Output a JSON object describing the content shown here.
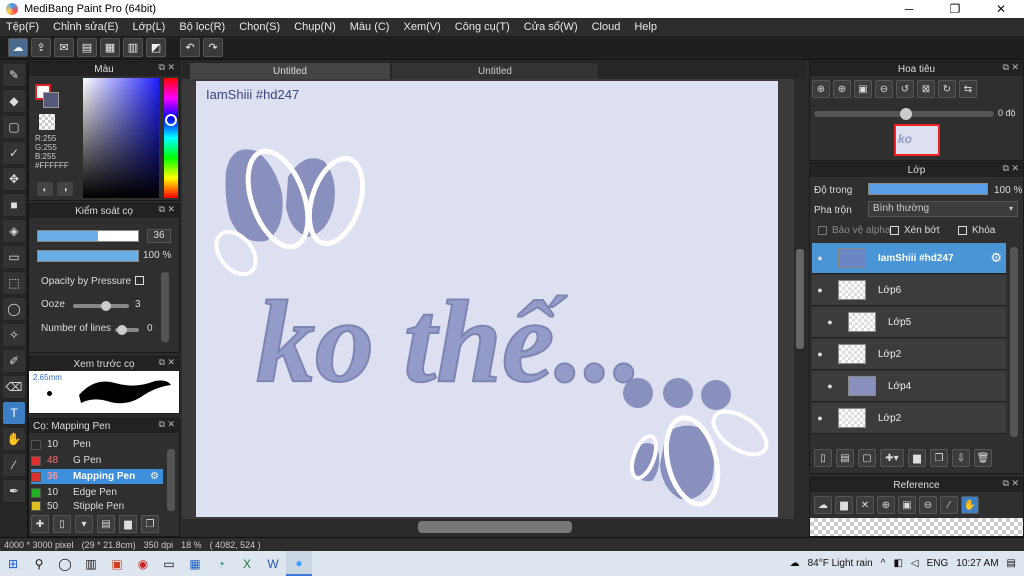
{
  "window": {
    "title": "MediBang Paint Pro (64bit)",
    "minimize": "─",
    "maximize": "❐",
    "close": "✕"
  },
  "menu": [
    "Tệp(F)",
    "Chỉnh sửa(E)",
    "Lớp(L)",
    "Bộ lọc(R)",
    "Chọn(S)",
    "Chụp(N)",
    "Màu (C)",
    "Xem(V)",
    "Công cụ(T)",
    "Cửa sổ(W)",
    "Cloud",
    "Help"
  ],
  "color_panel": {
    "title": "Màu",
    "rgb": "R:255\nG:255\nB:255\n#FFFFFF"
  },
  "brush_control": {
    "title": "Kiểm soát cọ",
    "size_value": "36",
    "size_fill": 0.6,
    "opacity_value": "100 %",
    "opacity_fill": 1.0,
    "opacity_pressure_label": "Opacity by Pressure",
    "ooze_label": "Ooze",
    "ooze_value": "3",
    "lines_label": "Number of lines",
    "lines_value": "0"
  },
  "brush_preview": {
    "title": "Xem trước cọ",
    "size_label": "2.65mm"
  },
  "brush_list": {
    "title": "Cọ: Mapping Pen",
    "items": [
      {
        "size": "10",
        "name": "Pen",
        "color": "#2a2a2a"
      },
      {
        "size": "48",
        "name": "G Pen",
        "color": "#e03030"
      },
      {
        "size": "36",
        "name": "Mapping Pen",
        "color": "#e03030",
        "selected": true
      },
      {
        "size": "10",
        "name": "Edge Pen",
        "color": "#20b020"
      },
      {
        "size": "50",
        "name": "Stipple Pen",
        "color": "#e0c020"
      }
    ]
  },
  "tabs": [
    "Untitled",
    "Untitled"
  ],
  "canvas": {
    "label": "IamShiii #hd247",
    "text": "ko thế..."
  },
  "navigator": {
    "title": "Hoa tiêu",
    "rotation": "0 độ"
  },
  "layers": {
    "title": "Lớp",
    "opacity_label": "Độ trong",
    "opacity_value": "100 %",
    "blend_label": "Pha trộn",
    "blend_value": "Bình thường",
    "protect_alpha": "Bảo vệ alpha",
    "clipping": "Xén bớt",
    "lock": "Khóa",
    "items": [
      {
        "name": "IamShiii #hd247",
        "selected": true
      },
      {
        "name": "Lớp6"
      },
      {
        "name": "Lớp5",
        "indent": true
      },
      {
        "name": "Lớp2"
      },
      {
        "name": "Lớp4",
        "indent": true
      },
      {
        "name": "Lớp2"
      }
    ]
  },
  "reference": {
    "title": "Reference"
  },
  "status": {
    "size": "4000 * 3000 pixel",
    "dims": "(29 * 21.8cm)",
    "dpi": "350 dpi",
    "zoom": "18 %",
    "coords": "( 4082, 524 )"
  },
  "taskbar": {
    "weather": "84°F  Light rain",
    "lang": "ENG",
    "time": "10:27 AM"
  }
}
